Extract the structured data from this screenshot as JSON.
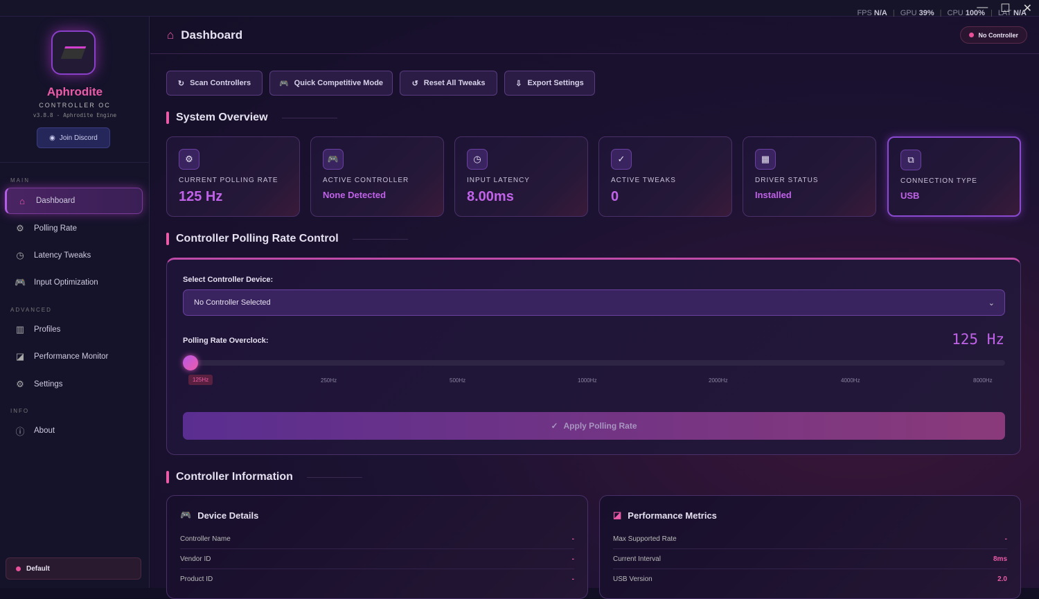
{
  "titlebar": {
    "stats": [
      {
        "label": "FPS",
        "value": "N/A"
      },
      {
        "label": "GPU",
        "value": "39%"
      },
      {
        "label": "CPU",
        "value": "100%"
      },
      {
        "label": "LAT",
        "value": "N/A"
      }
    ],
    "minimize": "—",
    "maximize": "☐",
    "close": "✕"
  },
  "sidebar": {
    "brand": "Aphrodite",
    "subtitle": "CONTROLLER OC",
    "version": "v3.8.8 - Aphrodite Engine",
    "discord": "Join Discord",
    "sections": {
      "main": "MAIN",
      "advanced": "ADVANCED",
      "info": "INFO"
    },
    "items": [
      {
        "label": "Dashboard",
        "icon": "⌂"
      },
      {
        "label": "Polling Rate",
        "icon": "⚙"
      },
      {
        "label": "Latency Tweaks",
        "icon": "◷"
      },
      {
        "label": "Input Optimization",
        "icon": "🎮"
      },
      {
        "label": "Profiles",
        "icon": "▥"
      },
      {
        "label": "Performance Monitor",
        "icon": "◪"
      },
      {
        "label": "Settings",
        "icon": "⚙"
      },
      {
        "label": "About",
        "icon": "ⓘ"
      }
    ],
    "profile": "Default"
  },
  "header": {
    "title": "Dashboard",
    "status": "No Controller"
  },
  "toolbar": [
    {
      "label": "Scan Controllers",
      "icon": "↻"
    },
    {
      "label": "Quick Competitive Mode",
      "icon": "🎮"
    },
    {
      "label": "Reset All Tweaks",
      "icon": "↺"
    },
    {
      "label": "Export Settings",
      "icon": "⇩"
    }
  ],
  "overview": {
    "title": "System Overview",
    "cards": [
      {
        "label": "CURRENT POLLING RATE",
        "value": "125 Hz",
        "icon": "⚙"
      },
      {
        "label": "ACTIVE CONTROLLER",
        "value": "None Detected",
        "icon": "🎮"
      },
      {
        "label": "INPUT LATENCY",
        "value": "8.00ms",
        "icon": "◷"
      },
      {
        "label": "ACTIVE TWEAKS",
        "value": "0",
        "icon": "✓"
      },
      {
        "label": "DRIVER STATUS",
        "value": "Installed",
        "icon": "▦"
      },
      {
        "label": "CONNECTION TYPE",
        "value": "USB",
        "icon": "⧉"
      }
    ]
  },
  "polling": {
    "title": "Controller Polling Rate Control",
    "select_label": "Select Controller Device:",
    "select_value": "No Controller Selected",
    "overclock_label": "Polling Rate Overclock:",
    "current": "125 Hz",
    "slider_fraction": 0,
    "ticks": [
      "125Hz",
      "250Hz",
      "500Hz",
      "1000Hz",
      "2000Hz",
      "4000Hz",
      "8000Hz"
    ],
    "apply": "Apply Polling Rate"
  },
  "info": {
    "title": "Controller Information",
    "device": {
      "title": "Device Details",
      "rows": [
        {
          "k": "Controller Name",
          "v": "-"
        },
        {
          "k": "Vendor ID",
          "v": "-"
        },
        {
          "k": "Product ID",
          "v": "-"
        }
      ]
    },
    "metrics": {
      "title": "Performance Metrics",
      "rows": [
        {
          "k": "Max Supported Rate",
          "v": "-"
        },
        {
          "k": "Current Interval",
          "v": "8ms"
        },
        {
          "k": "USB Version",
          "v": "2.0"
        }
      ]
    }
  }
}
